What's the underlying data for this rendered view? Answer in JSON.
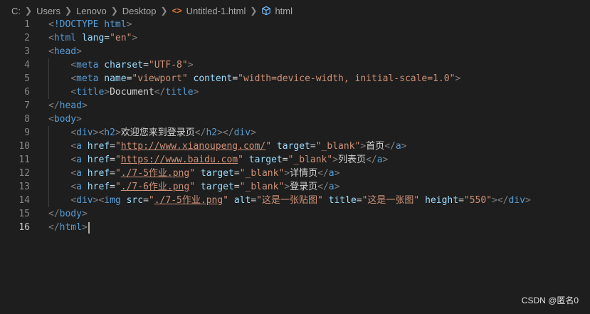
{
  "breadcrumb": {
    "segments": [
      "C:",
      "Users",
      "Lenovo",
      "Desktop",
      "Untitled-1.html",
      "html"
    ],
    "file_icon": "html-file-icon",
    "symbol_icon": "cube-icon"
  },
  "editor": {
    "active_line": 16,
    "lines": [
      {
        "n": "1",
        "tokens": [
          [
            "punc",
            "<"
          ],
          [
            "tag",
            "!DOCTYPE"
          ],
          [
            "text",
            " "
          ],
          [
            "tag",
            "html"
          ],
          [
            "punc",
            ">"
          ]
        ]
      },
      {
        "n": "2",
        "tokens": [
          [
            "punc",
            "<"
          ],
          [
            "tag",
            "html"
          ],
          [
            "text",
            " "
          ],
          [
            "attr",
            "lang"
          ],
          [
            "text",
            "="
          ],
          [
            "str",
            "\"en\""
          ],
          [
            "punc",
            ">"
          ]
        ]
      },
      {
        "n": "3",
        "tokens": [
          [
            "punc",
            "<"
          ],
          [
            "tag",
            "head"
          ],
          [
            "punc",
            ">"
          ]
        ]
      },
      {
        "n": "4",
        "tokens": [
          [
            "text",
            "    "
          ],
          [
            "punc",
            "<"
          ],
          [
            "tag",
            "meta"
          ],
          [
            "text",
            " "
          ],
          [
            "attr",
            "charset"
          ],
          [
            "text",
            "="
          ],
          [
            "str",
            "\"UTF-8\""
          ],
          [
            "punc",
            ">"
          ]
        ]
      },
      {
        "n": "5",
        "tokens": [
          [
            "text",
            "    "
          ],
          [
            "punc",
            "<"
          ],
          [
            "tag",
            "meta"
          ],
          [
            "text",
            " "
          ],
          [
            "attr",
            "name"
          ],
          [
            "text",
            "="
          ],
          [
            "str",
            "\"viewport\""
          ],
          [
            "text",
            " "
          ],
          [
            "attr",
            "content"
          ],
          [
            "text",
            "="
          ],
          [
            "str",
            "\"width=device-width, initial-scale=1.0\""
          ],
          [
            "punc",
            ">"
          ]
        ]
      },
      {
        "n": "6",
        "tokens": [
          [
            "text",
            "    "
          ],
          [
            "punc",
            "<"
          ],
          [
            "tag",
            "title"
          ],
          [
            "punc",
            ">"
          ],
          [
            "text",
            "Document"
          ],
          [
            "punc",
            "</"
          ],
          [
            "tag",
            "title"
          ],
          [
            "punc",
            ">"
          ]
        ]
      },
      {
        "n": "7",
        "tokens": [
          [
            "punc",
            "</"
          ],
          [
            "tag",
            "head"
          ],
          [
            "punc",
            ">"
          ]
        ]
      },
      {
        "n": "8",
        "tokens": [
          [
            "punc",
            "<"
          ],
          [
            "tag",
            "body"
          ],
          [
            "punc",
            ">"
          ]
        ]
      },
      {
        "n": "9",
        "tokens": [
          [
            "text",
            "    "
          ],
          [
            "punc",
            "<"
          ],
          [
            "tag",
            "div"
          ],
          [
            "punc",
            "><"
          ],
          [
            "tag",
            "h2"
          ],
          [
            "punc",
            ">"
          ],
          [
            "text",
            "欢迎您来到登录页"
          ],
          [
            "punc",
            "</"
          ],
          [
            "tag",
            "h2"
          ],
          [
            "punc",
            "></"
          ],
          [
            "tag",
            "div"
          ],
          [
            "punc",
            ">"
          ]
        ]
      },
      {
        "n": "10",
        "tokens": [
          [
            "text",
            "    "
          ],
          [
            "punc",
            "<"
          ],
          [
            "tag",
            "a"
          ],
          [
            "text",
            " "
          ],
          [
            "attr",
            "href"
          ],
          [
            "text",
            "="
          ],
          [
            "str",
            "\""
          ],
          [
            "link",
            "http://www.xianoupeng.com/"
          ],
          [
            "str",
            "\""
          ],
          [
            "text",
            " "
          ],
          [
            "attr",
            "target"
          ],
          [
            "text",
            "="
          ],
          [
            "str",
            "\"_blank\""
          ],
          [
            "punc",
            ">"
          ],
          [
            "text",
            "首页"
          ],
          [
            "punc",
            "</"
          ],
          [
            "tag",
            "a"
          ],
          [
            "punc",
            ">"
          ]
        ]
      },
      {
        "n": "11",
        "tokens": [
          [
            "text",
            "    "
          ],
          [
            "punc",
            "<"
          ],
          [
            "tag",
            "a"
          ],
          [
            "text",
            " "
          ],
          [
            "attr",
            "href"
          ],
          [
            "text",
            "="
          ],
          [
            "str",
            "\""
          ],
          [
            "link",
            "https://www.baidu.com"
          ],
          [
            "str",
            "\""
          ],
          [
            "text",
            " "
          ],
          [
            "attr",
            "target"
          ],
          [
            "text",
            "="
          ],
          [
            "str",
            "\"_blank\""
          ],
          [
            "punc",
            ">"
          ],
          [
            "text",
            "列表页"
          ],
          [
            "punc",
            "</"
          ],
          [
            "tag",
            "a"
          ],
          [
            "punc",
            ">"
          ]
        ]
      },
      {
        "n": "12",
        "tokens": [
          [
            "text",
            "    "
          ],
          [
            "punc",
            "<"
          ],
          [
            "tag",
            "a"
          ],
          [
            "text",
            " "
          ],
          [
            "attr",
            "href"
          ],
          [
            "text",
            "="
          ],
          [
            "str",
            "\""
          ],
          [
            "link",
            "./7-5作业.png"
          ],
          [
            "str",
            "\""
          ],
          [
            "text",
            " "
          ],
          [
            "attr",
            "target"
          ],
          [
            "text",
            "="
          ],
          [
            "str",
            "\"_blank\""
          ],
          [
            "punc",
            ">"
          ],
          [
            "text",
            "详情页"
          ],
          [
            "punc",
            "</"
          ],
          [
            "tag",
            "a"
          ],
          [
            "punc",
            ">"
          ]
        ]
      },
      {
        "n": "13",
        "tokens": [
          [
            "text",
            "    "
          ],
          [
            "punc",
            "<"
          ],
          [
            "tag",
            "a"
          ],
          [
            "text",
            " "
          ],
          [
            "attr",
            "href"
          ],
          [
            "text",
            "="
          ],
          [
            "str",
            "\""
          ],
          [
            "link",
            "./7-6作业.png"
          ],
          [
            "str",
            "\""
          ],
          [
            "text",
            " "
          ],
          [
            "attr",
            "target"
          ],
          [
            "text",
            "="
          ],
          [
            "str",
            "\"_blank\""
          ],
          [
            "punc",
            ">"
          ],
          [
            "text",
            "登录页"
          ],
          [
            "punc",
            "</"
          ],
          [
            "tag",
            "a"
          ],
          [
            "punc",
            ">"
          ]
        ]
      },
      {
        "n": "14",
        "tokens": [
          [
            "text",
            "    "
          ],
          [
            "punc",
            "<"
          ],
          [
            "tag",
            "div"
          ],
          [
            "punc",
            "><"
          ],
          [
            "tag",
            "img"
          ],
          [
            "text",
            " "
          ],
          [
            "attr",
            "src"
          ],
          [
            "text",
            "="
          ],
          [
            "str",
            "\""
          ],
          [
            "link",
            "./7-5作业.png"
          ],
          [
            "str",
            "\""
          ],
          [
            "text",
            " "
          ],
          [
            "attr",
            "alt"
          ],
          [
            "text",
            "="
          ],
          [
            "str",
            "\"这是一张贴图\""
          ],
          [
            "text",
            " "
          ],
          [
            "attr",
            "title"
          ],
          [
            "text",
            "="
          ],
          [
            "str",
            "\"这是一张图\""
          ],
          [
            "text",
            " "
          ],
          [
            "attr",
            "height"
          ],
          [
            "text",
            "="
          ],
          [
            "str",
            "\"550\""
          ],
          [
            "punc",
            "></"
          ],
          [
            "tag",
            "div"
          ],
          [
            "punc",
            ">"
          ]
        ]
      },
      {
        "n": "15",
        "tokens": [
          [
            "punc",
            "</"
          ],
          [
            "tag",
            "body"
          ],
          [
            "punc",
            ">"
          ]
        ]
      },
      {
        "n": "16",
        "tokens": [
          [
            "punc",
            "</"
          ],
          [
            "tag",
            "html"
          ],
          [
            "punc",
            ">"
          ]
        ]
      }
    ]
  },
  "watermark": "CSDN @匿名0",
  "colors": {
    "background": "#1e1e1e",
    "tag": "#569cd6",
    "attribute": "#9cdcfe",
    "string": "#ce9178",
    "punctuation": "#808080",
    "text": "#d4d4d4",
    "line_number": "#858585"
  }
}
